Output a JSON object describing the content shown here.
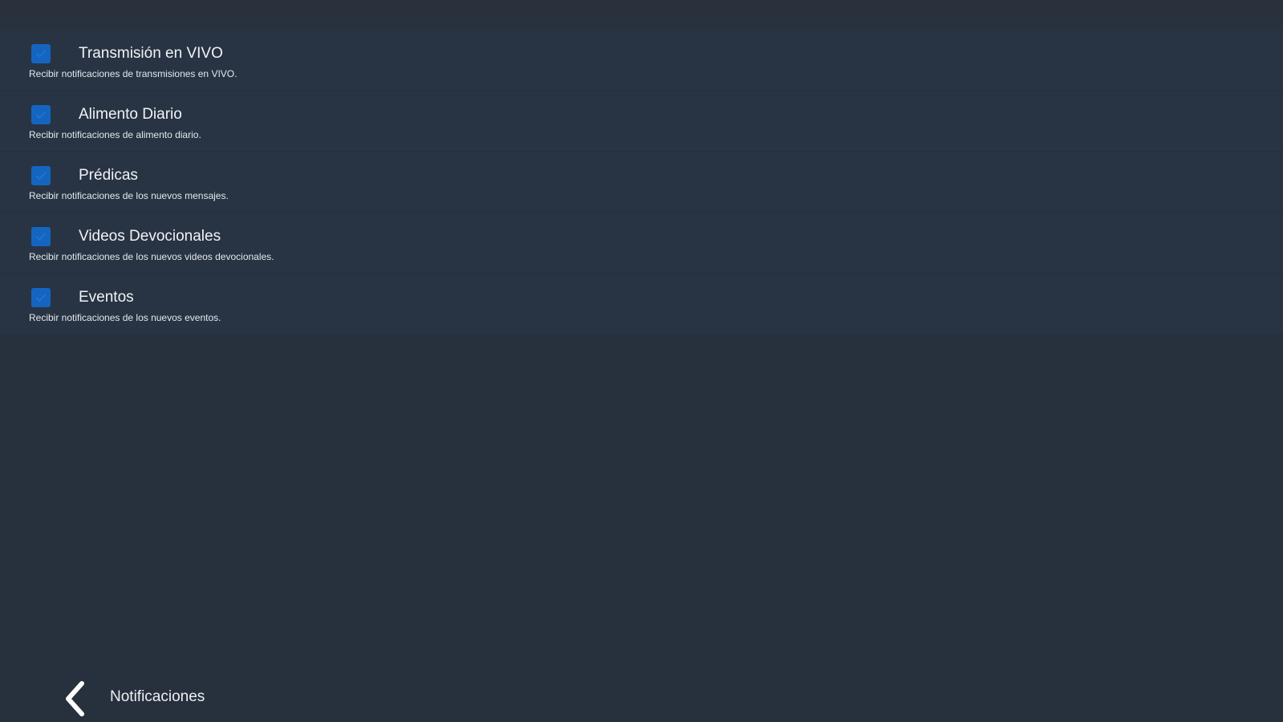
{
  "header": {
    "title": "Notificaciones",
    "back_icon": "chevron-left-icon"
  },
  "settings": [
    {
      "title": "Transmisión en VIVO",
      "description": "Recibir notificaciones de transmisiones en VIVO.",
      "checked": true
    },
    {
      "title": "Alimento Diario",
      "description": "Recibir notificaciones de alimento diario.",
      "checked": true
    },
    {
      "title": "Prédicas",
      "description": "Recibir notificaciones de los nuevos mensajes.",
      "checked": true
    },
    {
      "title": "Videos Devocionales",
      "description": "Recibir notificaciones de los nuevos videos devocionales.",
      "checked": true
    },
    {
      "title": "Eventos",
      "description": "Recibir notificaciones de los nuevos eventos.",
      "checked": true
    }
  ],
  "colors": {
    "background": "#27303d",
    "row_background": "#283444",
    "checkbox_accent": "#1565c0",
    "text": "#ffffff"
  }
}
